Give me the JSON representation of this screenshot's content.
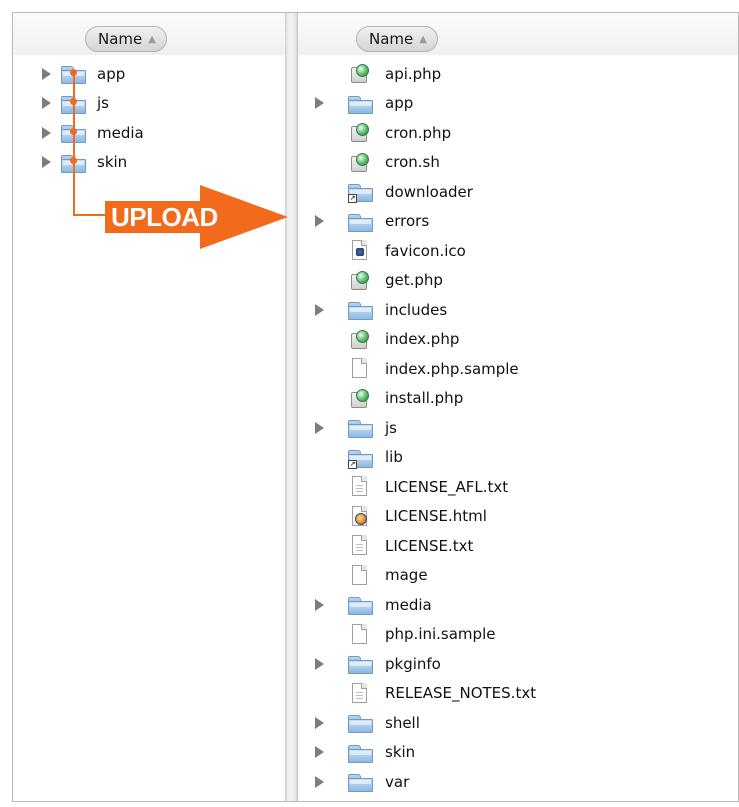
{
  "left_pane": {
    "header": {
      "sort_label": "Name",
      "sort_arrow": "▲"
    },
    "rows": [
      {
        "label": "app",
        "icon": "folder-icon",
        "expandable": true
      },
      {
        "label": "js",
        "icon": "folder-icon",
        "expandable": true
      },
      {
        "label": "media",
        "icon": "folder-icon",
        "expandable": true
      },
      {
        "label": "skin",
        "icon": "folder-icon",
        "expandable": true
      }
    ]
  },
  "annotation": {
    "label": "UPLOAD",
    "color": "#f26a1b"
  },
  "right_pane": {
    "header": {
      "sort_label": "Name",
      "sort_arrow": "▲"
    },
    "rows": [
      {
        "label": "api.php",
        "icon": "php-file-icon",
        "expandable": false
      },
      {
        "label": "app",
        "icon": "folder-icon",
        "expandable": true
      },
      {
        "label": "cron.php",
        "icon": "php-file-icon",
        "expandable": false
      },
      {
        "label": "cron.sh",
        "icon": "php-file-icon",
        "expandable": false
      },
      {
        "label": "downloader",
        "icon": "folder-alias-icon",
        "expandable": false
      },
      {
        "label": "errors",
        "icon": "folder-icon",
        "expandable": true
      },
      {
        "label": "favicon.ico",
        "icon": "ico-file-icon",
        "expandable": false
      },
      {
        "label": "get.php",
        "icon": "php-file-icon",
        "expandable": false
      },
      {
        "label": "includes",
        "icon": "folder-icon",
        "expandable": true
      },
      {
        "label": "index.php",
        "icon": "php-file-icon",
        "expandable": false
      },
      {
        "label": "index.php.sample",
        "icon": "blank-file-icon",
        "expandable": false
      },
      {
        "label": "install.php",
        "icon": "php-file-icon",
        "expandable": false
      },
      {
        "label": "js",
        "icon": "folder-icon",
        "expandable": true
      },
      {
        "label": "lib",
        "icon": "folder-alias-icon",
        "expandable": false
      },
      {
        "label": "LICENSE_AFL.txt",
        "icon": "text-file-icon",
        "expandable": false
      },
      {
        "label": "LICENSE.html",
        "icon": "html-file-icon",
        "expandable": false
      },
      {
        "label": "LICENSE.txt",
        "icon": "text-file-icon",
        "expandable": false
      },
      {
        "label": "mage",
        "icon": "blank-file-icon",
        "expandable": false
      },
      {
        "label": "media",
        "icon": "folder-icon",
        "expandable": true
      },
      {
        "label": "php.ini.sample",
        "icon": "blank-file-icon",
        "expandable": false
      },
      {
        "label": "pkginfo",
        "icon": "folder-icon",
        "expandable": true
      },
      {
        "label": "RELEASE_NOTES.txt",
        "icon": "text-file-icon",
        "expandable": false
      },
      {
        "label": "shell",
        "icon": "folder-icon",
        "expandable": true
      },
      {
        "label": "skin",
        "icon": "folder-icon",
        "expandable": true
      },
      {
        "label": "var",
        "icon": "folder-icon",
        "expandable": true
      }
    ]
  }
}
